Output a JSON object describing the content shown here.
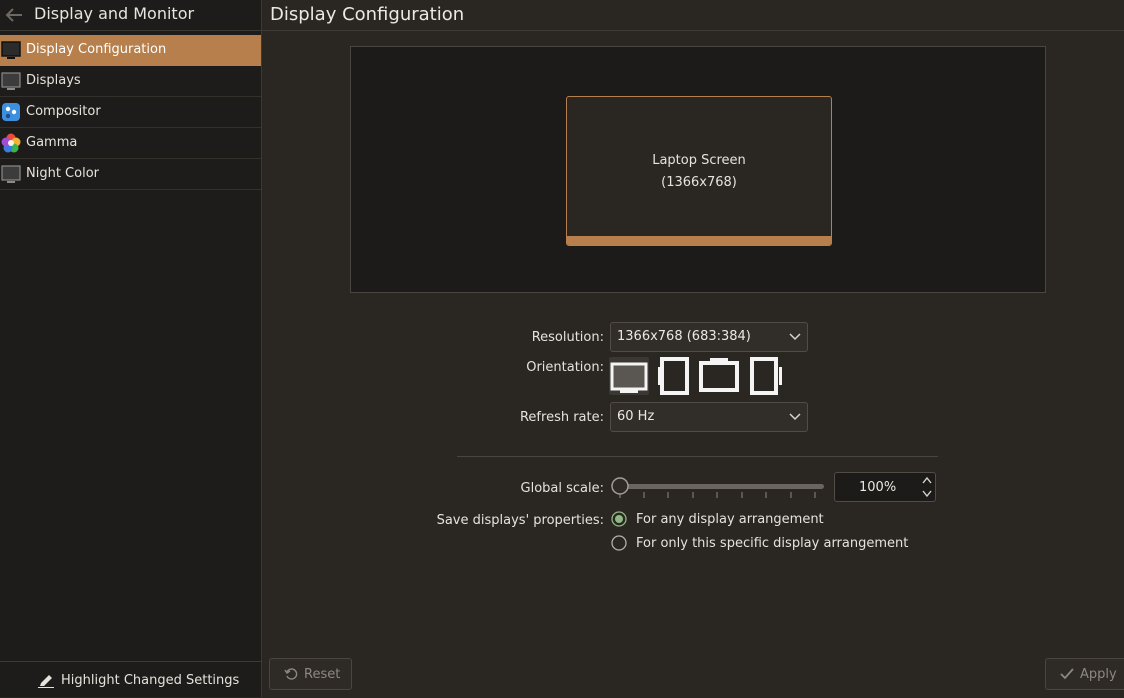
{
  "sidebar": {
    "title": "Display and Monitor",
    "items": [
      {
        "label": "Display Configuration",
        "icon": "monitor-icon",
        "active": true
      },
      {
        "label": "Displays",
        "icon": "monitor-icon",
        "active": false
      },
      {
        "label": "Compositor",
        "icon": "compositor-icon",
        "active": false
      },
      {
        "label": "Gamma",
        "icon": "gamma-icon",
        "active": false
      },
      {
        "label": "Night Color",
        "icon": "monitor-icon",
        "active": false
      }
    ],
    "footer_label": "Highlight Changed Settings"
  },
  "main": {
    "title": "Display Configuration",
    "screen": {
      "name": "Laptop Screen",
      "resolution": "(1366x768)"
    },
    "resolution": {
      "label": "Resolution:",
      "value": "1366x768 (683:384)"
    },
    "orientation": {
      "label": "Orientation:",
      "selected_index": 0
    },
    "refresh_rate": {
      "label": "Refresh rate:",
      "value": "60 Hz"
    },
    "global_scale": {
      "label": "Global scale:",
      "value": "100%",
      "slider_fraction": 0.0
    },
    "save_properties": {
      "label": "Save displays' properties:",
      "options": [
        {
          "label": "For any display arrangement",
          "checked": true
        },
        {
          "label": "For only this specific display arrangement",
          "checked": false
        }
      ]
    }
  },
  "buttons": {
    "reset": "Reset",
    "apply": "Apply"
  },
  "colors": {
    "accent": "#b67f4b",
    "background": "#2a2622",
    "sidebar": "#1e1c1a"
  }
}
